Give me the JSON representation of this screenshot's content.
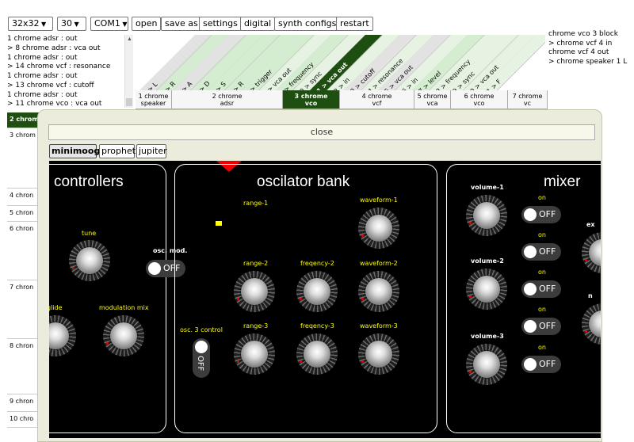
{
  "toolbar": {
    "grid": "32x32",
    "rate": "30",
    "port": "COM1",
    "open": "open",
    "save_as": "save as",
    "settings": "settings",
    "digital": "digital",
    "synth_configs": "synth configs",
    "restart": "restart"
  },
  "log_left": [
    "1 chrome adsr : out",
    "> 8 chrome adsr : vca out",
    "1 chrome adsr : out",
    "> 14 chrome vcf : resonance",
    "1 chrome adsr : out",
    "> 13 chrome vcf : cutoff",
    "1 chrome adsr : out",
    "> 11 chrome vco : vca out"
  ],
  "log_right": [
    "chrome vco 3 block",
    "> chrome vcf 4 in",
    "chrome vcf 4 out",
    "> chrome speaker 1 L"
  ],
  "connectors": [
    "1 > L",
    "2 > R",
    "3 > A",
    "4 > D",
    "5 > S",
    "6 > R",
    "7 > trigger",
    "8 > vca out",
    "9 > frequency",
    "10 > sync",
    "11 > vca out",
    "12 > in",
    "13 > cutoff",
    "14 > resonance",
    "15 > vca out",
    "16 > in",
    "17 > level",
    "18 > frequency",
    "19 > sync",
    "20 > vca out",
    "21 > F"
  ],
  "nodes": [
    {
      "line1": "1 chrome",
      "line2": "speaker"
    },
    {
      "line1": "2 chrome",
      "line2": "adsr"
    },
    {
      "line1": "3 chrome",
      "line2": "vco"
    },
    {
      "line1": "4 chrome",
      "line2": "vcf"
    },
    {
      "line1": "5 chrome",
      "line2": "vca"
    },
    {
      "line1": "6 chrome",
      "line2": "vco"
    },
    {
      "line1": "7 chrome",
      "line2": "vc"
    }
  ],
  "rows": [
    "2 chrome",
    "3 chrom",
    "4 chron",
    "5 chron",
    "6 chron",
    "7 chron",
    "8 chron",
    "9 chron",
    "10 chro"
  ],
  "overlay": {
    "close": "close",
    "tabs": [
      "minimoog",
      "prophet",
      "jupiter"
    ]
  },
  "panels": {
    "controllers": "controllers",
    "oscillator": "oscilator bank",
    "mixer": "mixer"
  },
  "labels": {
    "tune": "tune",
    "glide": "glide",
    "modulation_mix": "modulation mix",
    "osc_mod": "osc. mod.",
    "osc3_control": "osc. 3 control",
    "range1": "range-1",
    "range2": "range-2",
    "range3": "range-3",
    "freq2": "freqency-2",
    "freq3": "freqency-3",
    "wave1": "waveform-1",
    "wave2": "waveform-2",
    "wave3": "waveform-3",
    "vol1": "volume-1",
    "vol2": "volume-2",
    "vol3": "volume-3",
    "on": "on",
    "ex": "ex",
    "n": "n"
  },
  "toggle_off": "OFF"
}
